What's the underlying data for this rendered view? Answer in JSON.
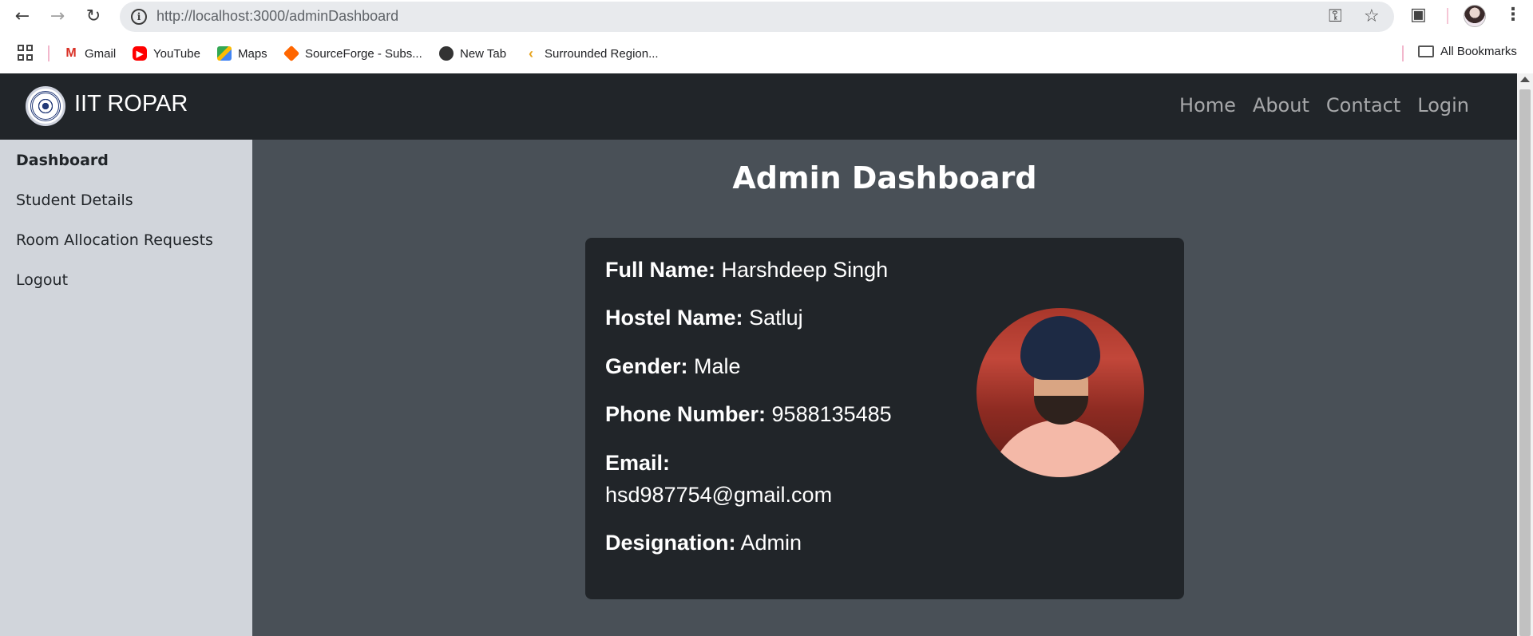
{
  "browser": {
    "url": "http://localhost:3000/adminDashboard",
    "icons": {
      "back": "back-arrow-icon",
      "forward": "forward-arrow-icon",
      "reload": "reload-icon",
      "site_info": "info-icon",
      "password": "key-icon",
      "bookmark_star": "star-icon",
      "extensions": "puzzle-icon",
      "menu": "kebab-menu-icon"
    }
  },
  "bookmarks": {
    "items": [
      {
        "label": "Gmail",
        "icon": "gmail-icon"
      },
      {
        "label": "YouTube",
        "icon": "youtube-icon"
      },
      {
        "label": "Maps",
        "icon": "maps-icon"
      },
      {
        "label": "SourceForge - Subs...",
        "icon": "sourceforge-icon"
      },
      {
        "label": "New Tab",
        "icon": "globe-icon"
      },
      {
        "label": "Surrounded Region...",
        "icon": "leetcode-icon"
      }
    ],
    "all_bookmarks": "All Bookmarks"
  },
  "navbar": {
    "brand": "IIT ROPAR",
    "links": [
      "Home",
      "About",
      "Contact",
      "Login"
    ]
  },
  "sidebar": {
    "items": [
      {
        "label": "Dashboard",
        "active": true
      },
      {
        "label": "Student Details",
        "active": false
      },
      {
        "label": "Room Allocation Requests",
        "active": false
      },
      {
        "label": "Logout",
        "active": false
      }
    ]
  },
  "main": {
    "title": "Admin Dashboard",
    "profile": {
      "full_name_label": "Full Name:",
      "full_name": "Harshdeep Singh",
      "hostel_label": "Hostel Name:",
      "hostel": "Satluj",
      "gender_label": "Gender:",
      "gender": "Male",
      "phone_label": "Phone Number:",
      "phone": "9588135485",
      "email_label": "Email:",
      "email": "hsd987754@gmail.com",
      "designation_label": "Designation:",
      "designation": "Admin"
    }
  },
  "colors": {
    "navbar_bg": "#212529",
    "sidebar_bg": "#d1d5db",
    "content_bg": "#495057",
    "card_bg": "#212529"
  }
}
